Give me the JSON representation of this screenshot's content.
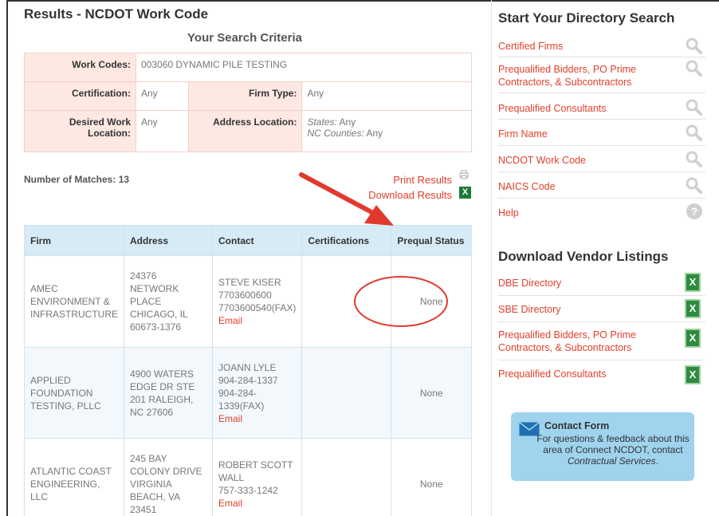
{
  "left": {
    "page_title": "Results - NCDOT Work Code",
    "criteria_title": "Your Search Criteria",
    "criteria": {
      "work_codes_label": "Work Codes:",
      "work_codes_value": "003060 DYNAMIC PILE TESTING",
      "certification_label": "Certification:",
      "certification_value": "Any",
      "firm_type_label": "Firm Type:",
      "firm_type_value": "Any",
      "desired_work_label": "Desired Work Location:",
      "desired_work_value": "Any",
      "address_label": "Address Location:",
      "states_label": "States:",
      "states_value": "Any",
      "nc_counties_label": "NC Counties:",
      "nc_counties_value": "Any"
    },
    "matches_label": "Number of Matches:",
    "matches_count": "13",
    "print_results": "Print Results",
    "download_results": "Download Results",
    "columns": [
      "Firm",
      "Address",
      "Contact",
      "Certifications",
      "Prequal Status"
    ],
    "rows": [
      {
        "firm": "AMEC ENVIRONMENT & INFRASTRUCTURE",
        "address": "24376 NETWORK PLACE CHICAGO, IL 60673-1376",
        "contact_name": "STEVE KISER",
        "contact_phone": "7703600600",
        "contact_fax": "7703600540(FAX)",
        "email": "Email",
        "certifications": "",
        "prequal": "None"
      },
      {
        "firm": "APPLIED FOUNDATION TESTING, PLLC",
        "address": "4900 WATERS EDGE DR STE 201 RALEIGH, NC 27606",
        "contact_name": "JOANN LYLE",
        "contact_phone": "904-284-1337",
        "contact_fax": "904-284-1339(FAX)",
        "email": "Email",
        "certifications": "",
        "prequal": "None"
      },
      {
        "firm": "ATLANTIC COAST ENGINEERING, LLC",
        "address": "245 BAY COLONY DRIVE VIRGINIA BEACH, VA 23451",
        "contact_name": "ROBERT SCOTT WALL",
        "contact_phone": "757-333-1242",
        "contact_fax": "",
        "email": "Email",
        "certifications": "",
        "prequal": "None"
      }
    ]
  },
  "right": {
    "search_heading": "Start Your Directory Search",
    "search_items": [
      "Certified Firms",
      "Prequalified Bidders, PO Prime Contractors, & Subcontractors",
      "Prequalified Consultants",
      "Firm Name",
      "NCDOT Work Code",
      "NAICS Code",
      "Help"
    ],
    "download_heading": "Download Vendor Listings",
    "download_items": [
      "DBE Directory",
      "SBE Directory",
      "Prequalified Bidders, PO Prime Contractors, & Subcontractors",
      "Prequalified Consultants"
    ],
    "contact": {
      "title": "Contact Form",
      "text_pre": "For questions & feedback about this area of Connect NCDOT, contact ",
      "text_em": "Contractual Services",
      "text_post": "."
    }
  },
  "icons": {
    "search": "magnifier-icon",
    "help": "help-icon",
    "excel": "excel-icon",
    "print": "print-icon",
    "envelope": "envelope-icon"
  },
  "colors": {
    "link": "#e0402a",
    "criteria_bg": "#fde8e2",
    "table_header_bg": "#d7ebf6",
    "contact_bg": "#9fd3ee",
    "annotation_red": "#e03a2f"
  }
}
